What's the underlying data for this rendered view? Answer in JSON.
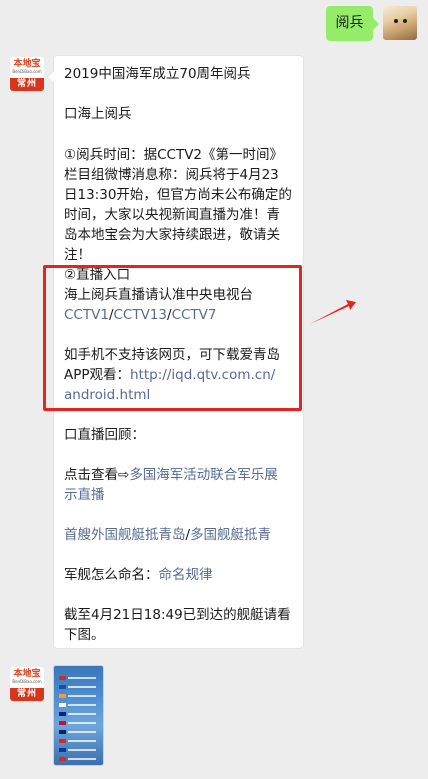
{
  "outgoing": {
    "text": "阅兵"
  },
  "brand": {
    "logo": "本地宝",
    "site": "BenDiBao.com",
    "city": "常州"
  },
  "message": {
    "lines": [
      "2019中国海军成立70周年阅兵",
      "",
      "口海上阅兵",
      "",
      "①阅兵时间：据CCTV2《第一时间》",
      "栏目组微博消息称：阅兵将于4月23",
      "日13:30开始，但官方尚未公布确定的",
      "时间，大家以央视新闻直播为准！青",
      "岛本地宝会为大家持续跟进，敬请关",
      "注！",
      "②直播入口",
      "海上阅兵直播请认准中央电视台"
    ],
    "cctv_links": [
      "CCTV1",
      "CCTV13",
      "CCTV7"
    ],
    "link_sep": "/",
    "app_line1": "如手机不支持该网页，可下载爱青岛",
    "app_prefix": "APP观看：",
    "app_url_part1": "http://iqd.qtv.com.cn/",
    "app_url_part2": "android.html",
    "review_heading": "口直播回顾：",
    "click_prefix": "点击查看⇨",
    "review_link_part1": "多国海军活动联合军乐展",
    "review_link_part2": "示直播",
    "ship_link1": "首艘外国舰艇抵青岛",
    "ship_link2": "多国舰艇抵青",
    "naming_prefix": "军舰怎么命名：",
    "naming_link": "命名规律",
    "arrival_line1": "截至4月21日18:49已到达的舰艇请看",
    "arrival_line2": "下图。"
  },
  "colors": {
    "link": "#576b95",
    "highlight": "#e5231f",
    "outgoing_bubble": "#95ec69"
  }
}
